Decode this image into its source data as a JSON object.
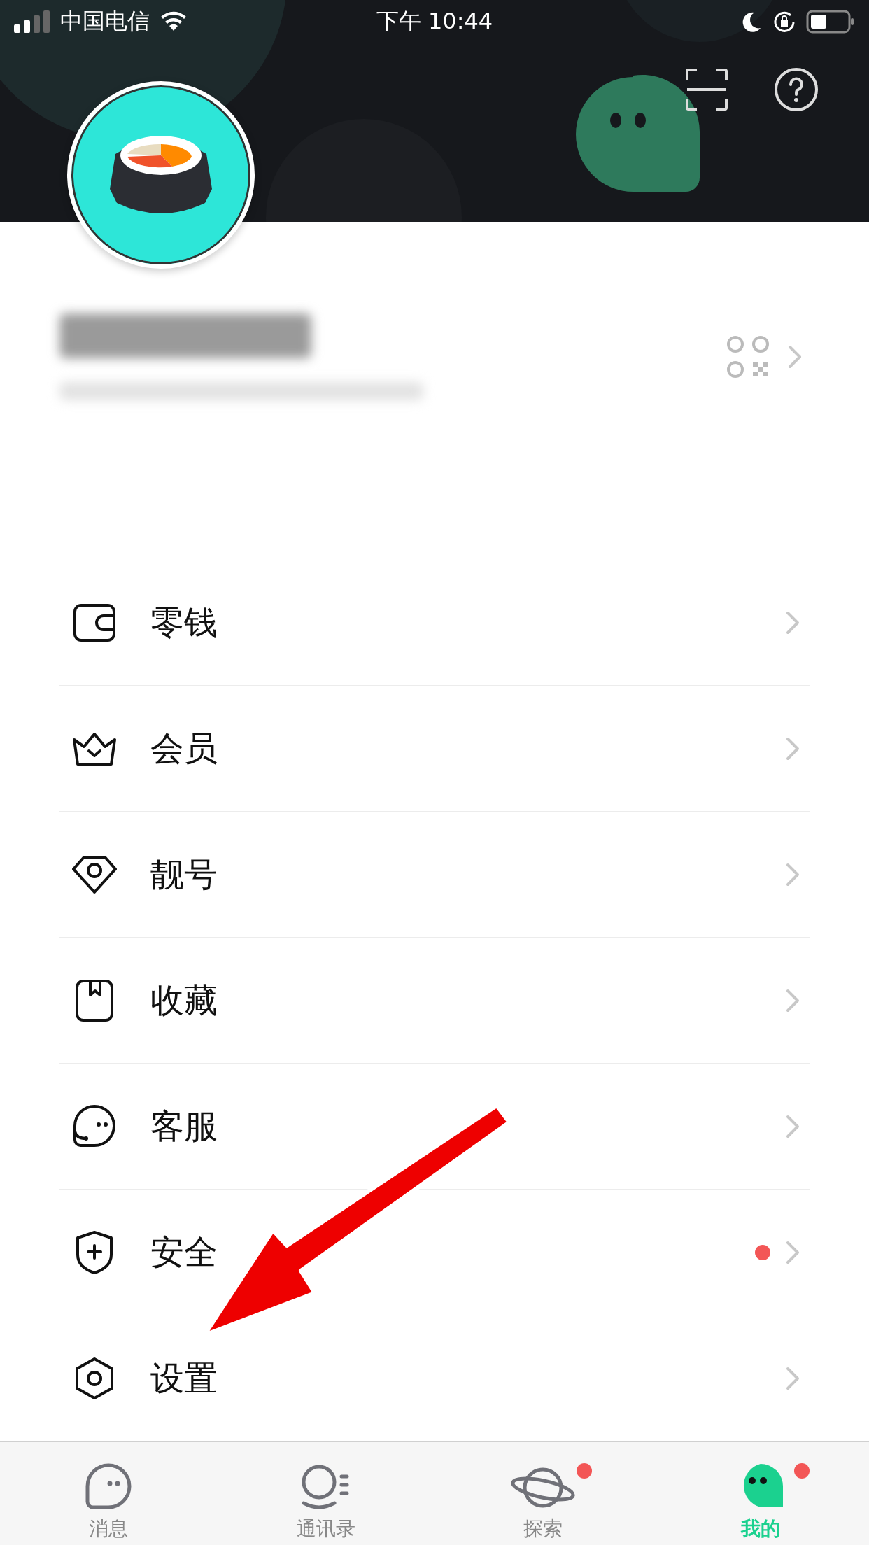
{
  "status_bar": {
    "carrier": "中国电信",
    "time": "下午 10:44"
  },
  "header": {
    "actions": [
      {
        "kind": "scan"
      },
      {
        "kind": "help"
      }
    ]
  },
  "profile": {
    "name_blurred": true
  },
  "menu": [
    {
      "kind": "wallet",
      "label": "零钱",
      "dot": false
    },
    {
      "kind": "crown",
      "label": "会员",
      "dot": false
    },
    {
      "kind": "id",
      "label": "靓号",
      "dot": false
    },
    {
      "kind": "bookmark",
      "label": "收藏",
      "dot": false
    },
    {
      "kind": "service",
      "label": "客服",
      "dot": false
    },
    {
      "kind": "shield",
      "label": "安全",
      "dot": true
    },
    {
      "kind": "gear",
      "label": "设置",
      "dot": false
    }
  ],
  "tab_bar": [
    {
      "kind": "message",
      "label": "消息",
      "selected": false,
      "badge": false
    },
    {
      "kind": "contacts",
      "label": "通讯录",
      "selected": false,
      "badge": false
    },
    {
      "kind": "planet",
      "label": "探索",
      "selected": false,
      "badge": true
    },
    {
      "kind": "me",
      "label": "我的",
      "selected": true,
      "badge": true
    }
  ]
}
